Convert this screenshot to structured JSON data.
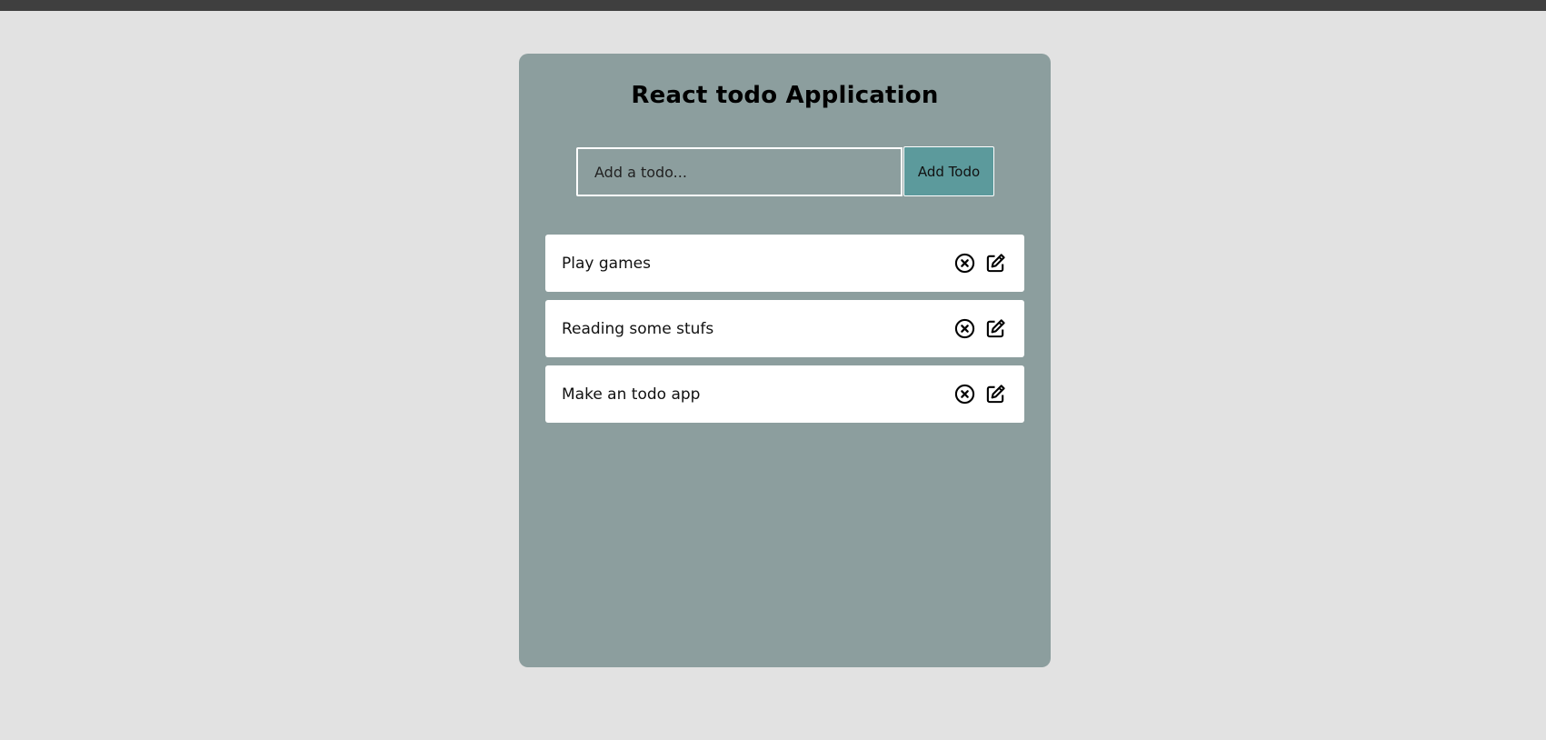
{
  "app": {
    "title": "React todo Application"
  },
  "form": {
    "input_placeholder": "Add a todo...",
    "input_value": "",
    "add_label": "Add Todo"
  },
  "todos": [
    {
      "text": "Play games"
    },
    {
      "text": "Reading some stufs"
    },
    {
      "text": "Make an todo app"
    }
  ],
  "icons": {
    "delete": "circle-x-icon",
    "edit": "edit-pencil-square-icon"
  },
  "colors": {
    "page_background": "#e2e2e2",
    "card_background": "#8c9e9e",
    "button_background": "#5c9a9c",
    "item_background": "#ffffff"
  }
}
